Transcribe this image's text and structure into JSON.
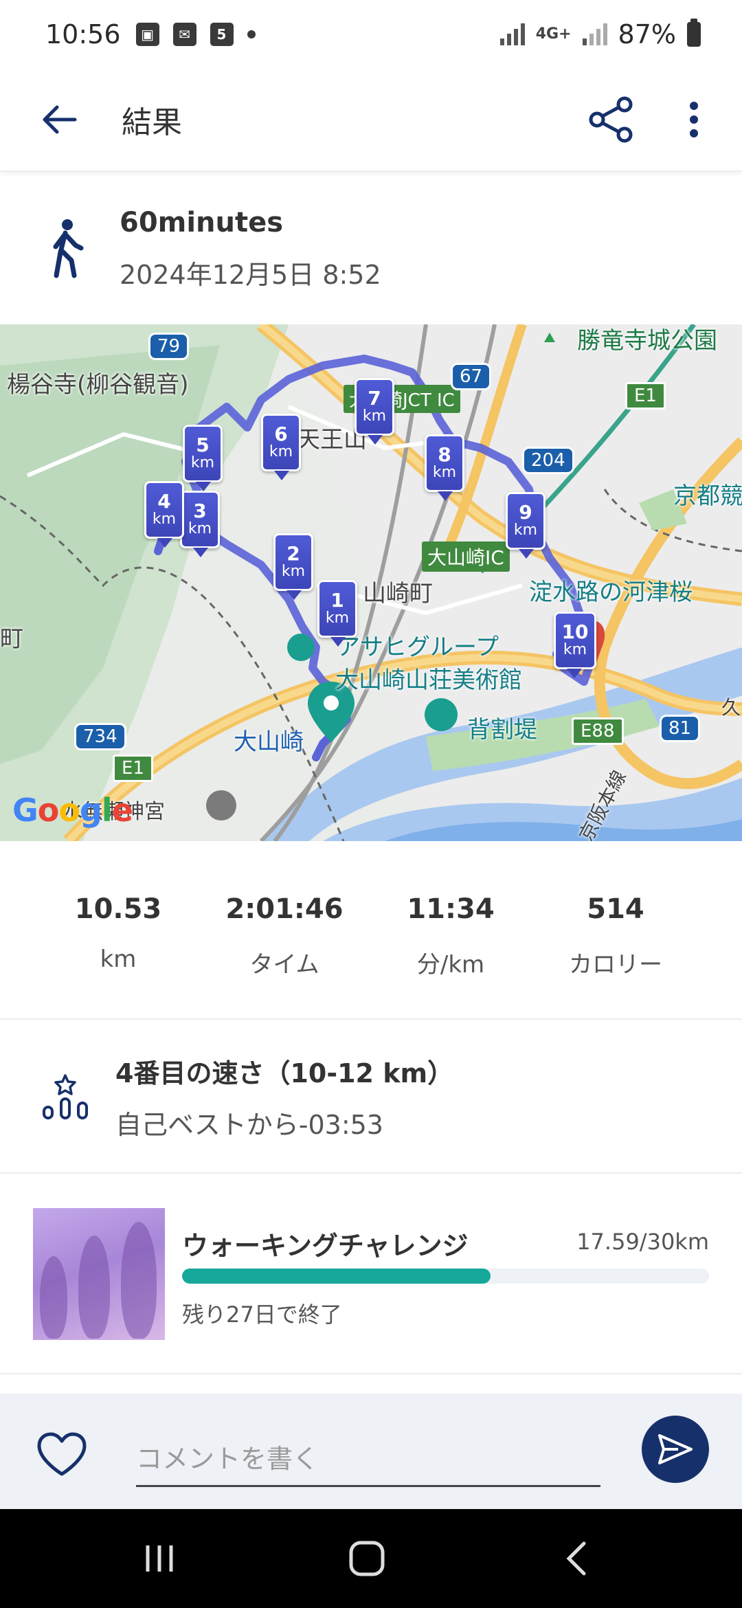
{
  "status_bar": {
    "time": "10:56",
    "network": "4G+",
    "battery": "87%",
    "notif_calendar": "5"
  },
  "app_bar": {
    "title": "結果",
    "back_icon": "arrow-left-icon",
    "share_icon": "share-icon",
    "more_icon": "more-vert-icon"
  },
  "activity": {
    "name": "60minutes",
    "date": "2024年12月5日 8:52",
    "icon": "walking-icon"
  },
  "map": {
    "places": {
      "yanagidani": "楊谷寺(柳谷観音)",
      "tennozan": "天王山",
      "yamazaki_town": "山崎町",
      "asahi": "アサヒグループ",
      "museum": "大山崎山荘美術館",
      "oyamazaki": "大山崎",
      "sewaritei": "背割堤",
      "yodo": "淀水路の河津桜",
      "shoryuji": "勝竜寺城公園",
      "kyoto": "京都競",
      "rikyu": "水無瀬神宮",
      "town_left": "町",
      "kyu": "久",
      "line": "京阪本線"
    },
    "ic_labels": [
      "大山崎IC",
      "大山崎JCT IC"
    ],
    "road_numbers": [
      "79",
      "67",
      "204",
      "734",
      "81",
      "E1",
      "E1",
      "E88"
    ],
    "markers": [
      {
        "n": "1",
        "unit": "km"
      },
      {
        "n": "2",
        "unit": "km"
      },
      {
        "n": "3",
        "unit": "km"
      },
      {
        "n": "4",
        "unit": "km"
      },
      {
        "n": "5",
        "unit": "km"
      },
      {
        "n": "6",
        "unit": "km"
      },
      {
        "n": "7",
        "unit": "km"
      },
      {
        "n": "8",
        "unit": "km"
      },
      {
        "n": "9",
        "unit": "km"
      },
      {
        "n": "10",
        "unit": "km"
      }
    ],
    "attribution": "Google"
  },
  "stats": [
    {
      "value": "10.53",
      "unit": "km"
    },
    {
      "value": "2:01:46",
      "unit": "タイム"
    },
    {
      "value": "11:34",
      "unit": "分/km"
    },
    {
      "value": "514",
      "unit": "カロリー"
    }
  ],
  "rank": {
    "title": "4番目の速さ（10-12 km）",
    "subtitle": "自己ベストから-03:53"
  },
  "challenge": {
    "title": "ウォーキングチャレンジ",
    "progress_text": "17.59/30km",
    "progress_fraction": 0.586,
    "remaining": "残り27日で終了"
  },
  "comment": {
    "placeholder": "コメントを書く"
  },
  "colors": {
    "route": "#5b63d8",
    "accent_navy": "#16306b",
    "progress": "#15a89a",
    "start_pin": "#1a9e8f",
    "end_pin": "#d9483b"
  }
}
